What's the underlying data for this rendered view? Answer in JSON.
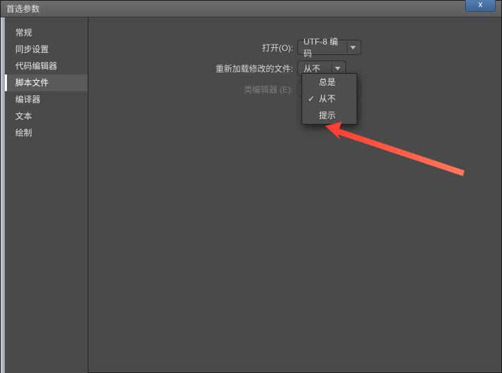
{
  "window": {
    "title": "首选参数",
    "close_label": "x"
  },
  "sidebar": {
    "items": [
      {
        "label": "常规"
      },
      {
        "label": "同步设置"
      },
      {
        "label": "代码编辑器"
      },
      {
        "label": "脚本文件"
      },
      {
        "label": "编译器"
      },
      {
        "label": "文本"
      },
      {
        "label": "绘制"
      }
    ],
    "selected_index": 3
  },
  "form": {
    "open_label": "打开(O):",
    "open_value": "UTF-8 编码",
    "reload_label": "重新加载修改的文件:",
    "reload_value": "从不",
    "class_editor_label": "类编辑器 (E):",
    "class_editor_value": ""
  },
  "reload_dropdown": {
    "options": [
      {
        "label": "总是",
        "checked": false
      },
      {
        "label": "从不",
        "checked": true
      },
      {
        "label": "提示",
        "checked": false
      }
    ]
  }
}
